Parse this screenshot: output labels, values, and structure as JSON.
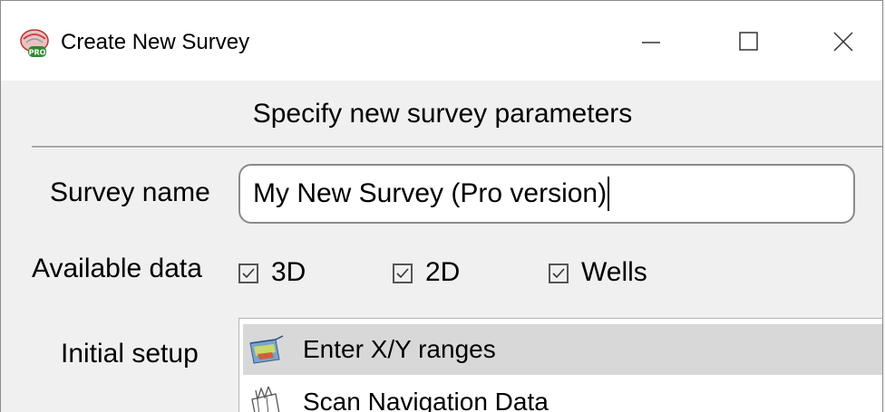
{
  "window": {
    "title": "Create New Survey",
    "icons": {
      "app": "pro-app-icon",
      "minimize": "minimize-icon",
      "maximize": "maximize-icon",
      "close": "close-icon"
    }
  },
  "heading": "Specify new survey parameters",
  "survey_name": {
    "label": "Survey name",
    "value": "My New Survey (Pro version)"
  },
  "available_data": {
    "label": "Available data",
    "options": [
      {
        "label": "3D",
        "checked": true
      },
      {
        "label": "2D",
        "checked": true
      },
      {
        "label": "Wells",
        "checked": true
      }
    ]
  },
  "initial_setup": {
    "label": "Initial setup",
    "items": [
      {
        "label": "Enter X/Y ranges",
        "icon": "xy-ranges-icon",
        "selected": true
      },
      {
        "label": "Scan Navigation Data",
        "icon": "scan-navigation-icon",
        "selected": false
      }
    ]
  },
  "colors": {
    "selection": "#d8d8d8",
    "background": "#f0f0f0",
    "titlebar": "#ffffff"
  }
}
